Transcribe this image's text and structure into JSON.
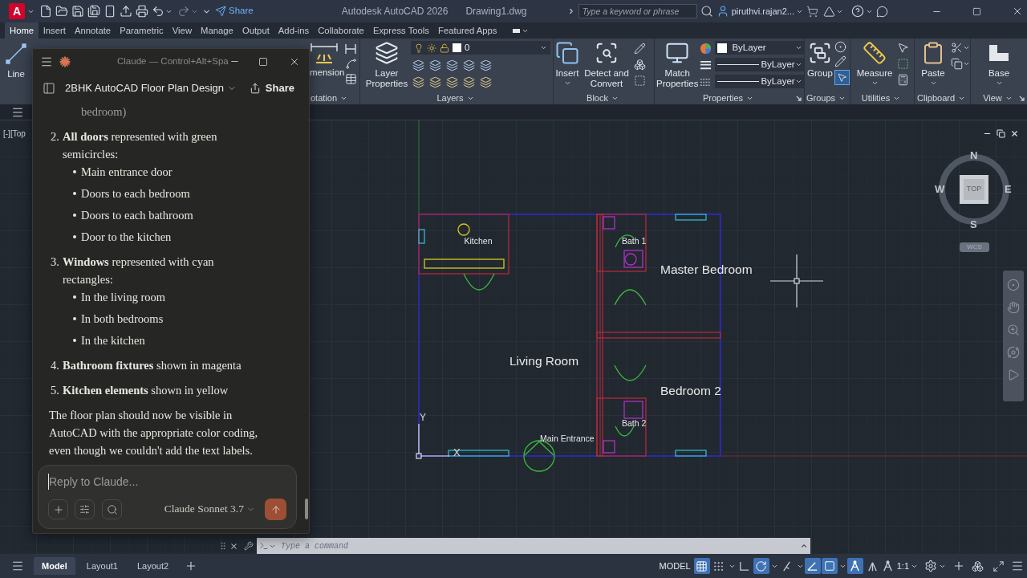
{
  "title_bar": {
    "logo_letter": "A",
    "share": "Share",
    "app_title": "Autodesk AutoCAD 2026",
    "file_name": "Drawing1.dwg",
    "search": {
      "placeholder": "Type a keyword or phrase"
    },
    "user": "piruthvi.rajan2..."
  },
  "ribbon_tabs": [
    {
      "label": "Home",
      "selected": true
    },
    {
      "label": "Insert",
      "selected": false
    },
    {
      "label": "Annotate",
      "selected": false
    },
    {
      "label": "Parametric",
      "selected": false
    },
    {
      "label": "View",
      "selected": false
    },
    {
      "label": "Manage",
      "selected": false
    },
    {
      "label": "Output",
      "selected": false
    },
    {
      "label": "Add-ins",
      "selected": false
    },
    {
      "label": "Collaborate",
      "selected": false
    },
    {
      "label": "Express Tools",
      "selected": false
    },
    {
      "label": "Featured Apps",
      "selected": false
    }
  ],
  "ribbon": {
    "draw": {
      "button": "Line"
    },
    "annotation": {
      "button": "mension",
      "title": "otation"
    },
    "layers": {
      "button": "Layer Properties",
      "current_layer": "0",
      "title": "Layers"
    },
    "block": {
      "buttons": [
        "Insert",
        "Detect and Convert"
      ],
      "title": "Block"
    },
    "properties": {
      "button": "Match Properties",
      "color_dropdown": "ByLayer",
      "lineweight_dropdown": "ByLayer",
      "linetype_dropdown": "ByLayer",
      "title": "Properties"
    },
    "groups": {
      "button": "Group",
      "selection_on": true,
      "title": "Groups"
    },
    "utilities": {
      "button": "Measure",
      "title": "Utilities"
    },
    "clipboard": {
      "button": "Paste",
      "title": "Clipboard"
    },
    "view": {
      "button": "Base",
      "title": "View"
    }
  },
  "viewport": {
    "label": "[-][Top",
    "plan_labels": [
      "Kitchen",
      "Bath 1",
      "Master Bedroom",
      "Living Room",
      "Bedroom 2",
      "Bath 2",
      "Main Entrance"
    ],
    "ucs": {
      "y": "Y",
      "x": "X"
    },
    "view_cube": {
      "face": "TOP",
      "north": "N",
      "south": "S",
      "east": "E",
      "west": "W",
      "coordinate_system": "WCS"
    }
  },
  "claude_window": {
    "title": "Claude — Control+Alt+Spa",
    "conversation": "2BHK AutoCAD Floor Plan Design",
    "share": "Share",
    "fragment": "bedroom)",
    "list": [
      {
        "number": "2.",
        "text": "**All doors** represented with green semicircles:",
        "bullets": [
          "Main entrance door",
          "Doors to each bedroom",
          "Doors to each bathroom",
          "Door to the kitchen"
        ]
      },
      {
        "number": "3.",
        "text": "**Windows** represented with cyan rectangles:",
        "bullets": [
          "In the living room",
          "In both bedrooms",
          "In the kitchen"
        ]
      },
      {
        "number": "4.",
        "text": "**Bathroom fixtures** shown in magenta"
      },
      {
        "number": "5.",
        "text": "**Kitchen elements** shown in yellow"
      }
    ],
    "paragraph": "The floor plan should now be visible in AutoCAD with the appropriate color coding, even though we couldn't add the text labels.",
    "reply": {
      "placeholder": "Reply to Claude..."
    },
    "model": "Claude Sonnet 3.7"
  },
  "command_line": {
    "placeholder": "Type a command"
  },
  "status_bar": {
    "layout_tabs": [
      {
        "label": "Model",
        "selected": true
      },
      {
        "label": "Layout1",
        "selected": false
      },
      {
        "label": "Layout2",
        "selected": false
      }
    ],
    "space": "MODEL",
    "toggles": [
      {
        "kind": "grid",
        "on": true
      },
      {
        "kind": "snap",
        "on": false
      },
      {
        "kind": "ortho",
        "on": false
      },
      {
        "kind": "polar",
        "on": true
      },
      {
        "kind": "isodraft",
        "on": false
      },
      {
        "kind": "tracking",
        "on": true
      },
      {
        "kind": "osnap",
        "on": true
      },
      {
        "kind": "annotation",
        "on": true
      }
    ],
    "scale": "1:1"
  }
}
